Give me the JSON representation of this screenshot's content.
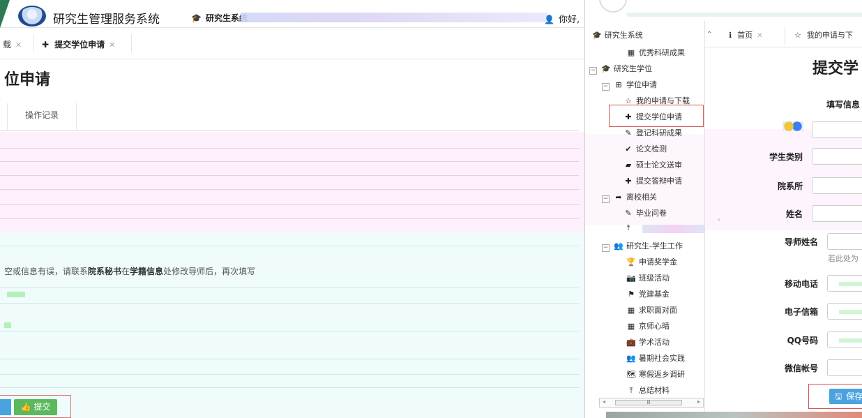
{
  "header": {
    "site_title": "研究生管理服务系统",
    "system_label": "研究生系统",
    "greeting": "你好,"
  },
  "left_tabs": {
    "partial_tab": "载",
    "submit_tab": "提交学位申请"
  },
  "left_page": {
    "heading": "位申请",
    "sub_tab": "操作记录",
    "notice_pre": "空或信息有误，请联系",
    "notice_b1": "院系秘书",
    "notice_mid": "在",
    "notice_b2": "学籍信息",
    "notice_post": "处修改导师后，再次填写",
    "submit_label": "提交"
  },
  "sidebar": {
    "top_label": "研究生系统",
    "items": [
      {
        "label": "优秀科研成果",
        "icon": "table-icon"
      },
      {
        "label": "研究生学位",
        "icon": "graduation-cap-icon"
      },
      {
        "label": "学位申请",
        "icon": "plus-square-icon"
      },
      {
        "label": "我的申请与下载",
        "icon": "star-outline-icon"
      },
      {
        "label": "提交学位申请",
        "icon": "plus-icon"
      },
      {
        "label": "登记科研成果",
        "icon": "pencil-icon"
      },
      {
        "label": "论文检测",
        "icon": "check-icon"
      },
      {
        "label": "硕士论文送审",
        "icon": "book-icon"
      },
      {
        "label": "提交答辩申请",
        "icon": "plus-icon"
      },
      {
        "label": "离校相关",
        "icon": "sign-out-icon"
      },
      {
        "label": "毕业问卷",
        "icon": "pencil-icon"
      },
      {
        "label": "研究生-学生工作",
        "icon": "users-icon"
      },
      {
        "label": "申请奖学金",
        "icon": "trophy-icon"
      },
      {
        "label": "班级活动",
        "icon": "camera-icon"
      },
      {
        "label": "党建基金",
        "icon": "flag-icon"
      },
      {
        "label": "求职面对面",
        "icon": "table-icon"
      },
      {
        "label": "京师心晴",
        "icon": "table-icon"
      },
      {
        "label": "学术活动",
        "icon": "briefcase-icon"
      },
      {
        "label": "暑期社会实践",
        "icon": "users-icon"
      },
      {
        "label": "寒假返乡调研",
        "icon": "map-icon"
      },
      {
        "label": "总结材料",
        "icon": "upload-icon"
      }
    ]
  },
  "right_tabs": {
    "home": "首页",
    "apply": "我的申请与下"
  },
  "right_page": {
    "title": "提交学",
    "fill_tab": "填写信息",
    "fields": {
      "student_type": "学生类别",
      "department": "院系所",
      "name": "姓名",
      "advisor": "导师姓名",
      "mobile": "移动电话",
      "email": "电子信箱",
      "qq": "QQ号码",
      "wechat": "微信帐号"
    },
    "helper": "若此处为",
    "save_label": "保存"
  },
  "colors": {
    "accent_green": "#5cb85c",
    "accent_blue": "#4aa3df",
    "highlight_red": "#d9534f"
  }
}
